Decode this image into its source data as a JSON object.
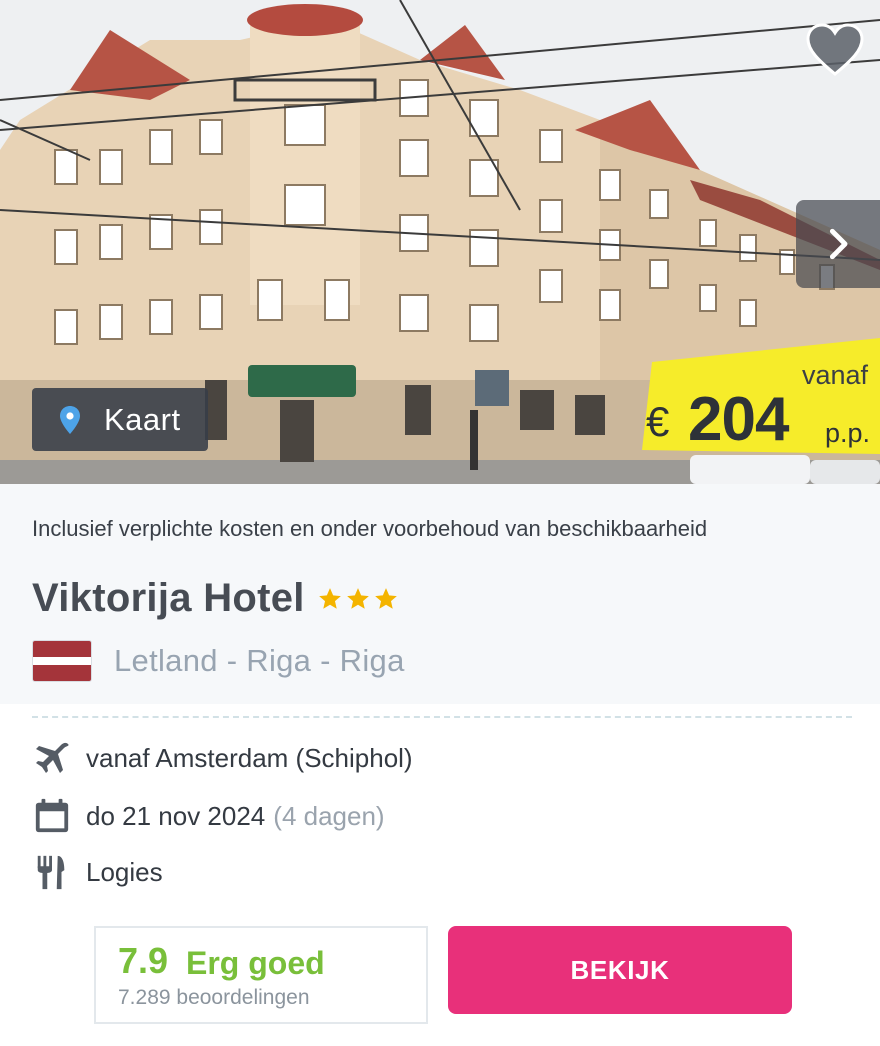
{
  "hero": {
    "photo_icon": "hotel-building-photo",
    "favorite_icon": "heart-icon",
    "next_icon": "chevron-right-icon",
    "map_button": {
      "icon": "map-pin-icon",
      "label": "Kaart"
    },
    "price": {
      "from_label": "vanaf",
      "currency": "€",
      "amount": "204",
      "per_person": "p.p."
    }
  },
  "card": {
    "disclaimer": "Inclusief verplichte kosten en onder voorbehoud van beschikbaarheid",
    "hotel_name": "Viktorija Hotel",
    "stars": 3,
    "flag_icon": "latvia-flag-icon",
    "location": "Letland - Riga - Riga"
  },
  "details": {
    "flight": {
      "icon": "airplane-icon",
      "text": "vanaf Amsterdam (Schiphol)"
    },
    "date": {
      "icon": "calendar-icon",
      "text": "do 21 nov 2024",
      "duration": "(4 dagen)"
    },
    "board": {
      "icon": "cutlery-icon",
      "text": "Logies"
    }
  },
  "rating": {
    "score": "7.9",
    "label": "Erg goed",
    "count": "7.289 beoordelingen"
  },
  "cta": {
    "label": "BEKIJK"
  },
  "colors": {
    "accent": "#e8307a",
    "rating_green": "#79bf3a",
    "star": "#f4b400",
    "price_bg": "#f6ec2a",
    "map_pin": "#4da3e8"
  }
}
